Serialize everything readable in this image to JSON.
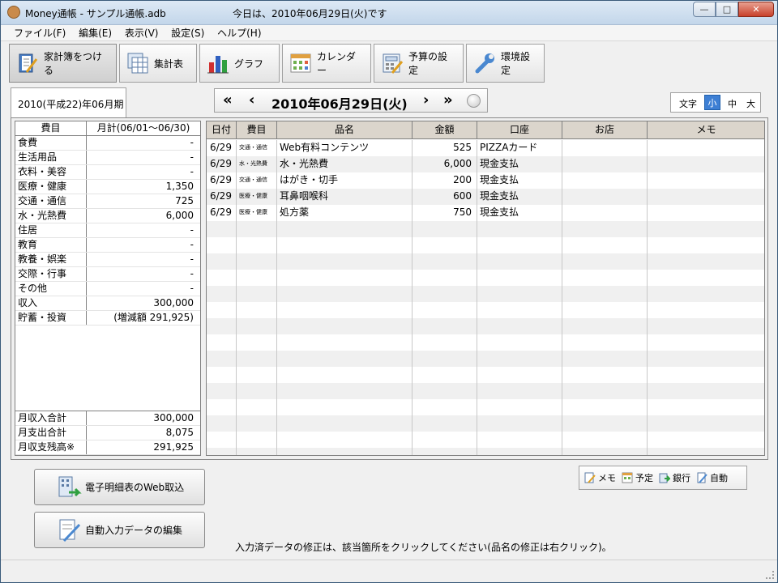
{
  "window": {
    "title": "Money通帳 - サンプル通帳.adb",
    "today": "今日は、2010年06月29日(火)です"
  },
  "menu": [
    "ファイル(F)",
    "編集(E)",
    "表示(V)",
    "設定(S)",
    "ヘルプ(H)"
  ],
  "toolbar": [
    {
      "label": "家計簿をつける",
      "icon": "notebook-pen-icon"
    },
    {
      "label": "集計表",
      "icon": "spreadsheet-icon"
    },
    {
      "label": "グラフ",
      "icon": "bar-chart-icon"
    },
    {
      "label": "カレンダー",
      "icon": "calendar-icon"
    },
    {
      "label": "予算の設定",
      "icon": "budget-calculator-icon"
    },
    {
      "label": "環境設定",
      "icon": "wrench-icon"
    }
  ],
  "period": "2010(平成22)年06月期",
  "datebar": {
    "first": "«",
    "prev": "‹",
    "date": "2010年06月29日(火)",
    "next": "›",
    "last": "»"
  },
  "textsize": {
    "label": "文字",
    "small": "小",
    "medium": "中",
    "large": "大"
  },
  "category_table": {
    "headers": [
      "費目",
      "月計(06/01〜06/30)"
    ],
    "rows": [
      {
        "name": "食費",
        "value": "-"
      },
      {
        "name": "生活用品",
        "value": "-"
      },
      {
        "name": "衣料・美容",
        "value": "-"
      },
      {
        "name": "医療・健康",
        "value": "1,350"
      },
      {
        "name": "交通・通信",
        "value": "725"
      },
      {
        "name": "水・光熱費",
        "value": "6,000"
      },
      {
        "name": "住居",
        "value": "-"
      },
      {
        "name": "教育",
        "value": "-"
      },
      {
        "name": "教養・娯楽",
        "value": "-"
      },
      {
        "name": "交際・行事",
        "value": "-"
      },
      {
        "name": "その他",
        "value": "-"
      },
      {
        "name": "収入",
        "value": "300,000"
      },
      {
        "name": "貯蓄・投資",
        "value": "(増減額 291,925)"
      }
    ],
    "totals": [
      {
        "name": "月収入合計",
        "value": "300,000"
      },
      {
        "name": "月支出合計",
        "value": "8,075"
      },
      {
        "name": "月収支残高※",
        "value": "291,925"
      }
    ]
  },
  "transactions": {
    "headers": [
      "日付",
      "費目",
      "品名",
      "金額",
      "口座",
      "お店",
      "メモ"
    ],
    "rows": [
      {
        "date": "6/29",
        "category": "交通・通信",
        "item": "Web有料コンテンツ",
        "amount": "525",
        "account": "PIZZAカード",
        "shop": "",
        "memo": ""
      },
      {
        "date": "6/29",
        "category": "水・光熱費",
        "item": "水・光熱費",
        "amount": "6,000",
        "account": "現金支払",
        "shop": "",
        "memo": ""
      },
      {
        "date": "6/29",
        "category": "交通・通信",
        "item": "はがき・切手",
        "amount": "200",
        "account": "現金支払",
        "shop": "",
        "memo": ""
      },
      {
        "date": "6/29",
        "category": "医療・健康",
        "item": "耳鼻咽喉科",
        "amount": "600",
        "account": "現金支払",
        "shop": "",
        "memo": ""
      },
      {
        "date": "6/29",
        "category": "医療・健康",
        "item": "処方薬",
        "amount": "750",
        "account": "現金支払",
        "shop": "",
        "memo": ""
      }
    ],
    "empty_rows": 15
  },
  "legend": [
    {
      "label": "メモ",
      "icon": "memo-icon"
    },
    {
      "label": "予定",
      "icon": "schedule-icon"
    },
    {
      "label": "銀行",
      "icon": "bank-icon"
    },
    {
      "label": "自動",
      "icon": "auto-icon"
    }
  ],
  "buttons": {
    "web_import": "電子明細表のWeb取込",
    "auto_edit": "自動入力データの編集"
  },
  "hint": "入力済データの修正は、該当箇所をクリックしてください(品名の修正は右クリック)。"
}
